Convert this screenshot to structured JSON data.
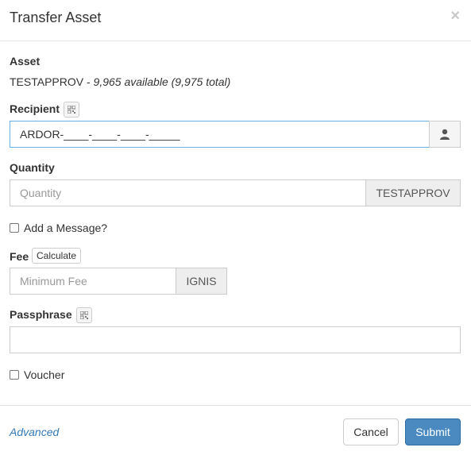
{
  "dialog": {
    "title": "Transfer Asset",
    "close_label": "×"
  },
  "asset": {
    "label": "Asset",
    "name": "TESTAPPROV",
    "separator": " - ",
    "availability": "9,965 available (9,975 total)"
  },
  "recipient": {
    "label": "Recipient",
    "value": "ARDOR-____-____-____-_____",
    "icons": {
      "qr": "qr-code-icon",
      "contact": "user-icon"
    }
  },
  "quantity": {
    "label": "Quantity",
    "placeholder": "Quantity",
    "unit": "TESTAPPROV"
  },
  "message": {
    "label": "Add a Message?",
    "checked": false
  },
  "fee": {
    "label": "Fee",
    "calculate_label": "Calculate",
    "placeholder": "Minimum Fee",
    "unit": "IGNIS"
  },
  "passphrase": {
    "label": "Passphrase",
    "value": ""
  },
  "voucher": {
    "label": "Voucher",
    "checked": false
  },
  "footer": {
    "advanced_label": "Advanced",
    "cancel_label": "Cancel",
    "submit_label": "Submit"
  },
  "colors": {
    "accent": "#4a8ac0",
    "link": "#337ab7",
    "focus_border": "#66afe9"
  }
}
